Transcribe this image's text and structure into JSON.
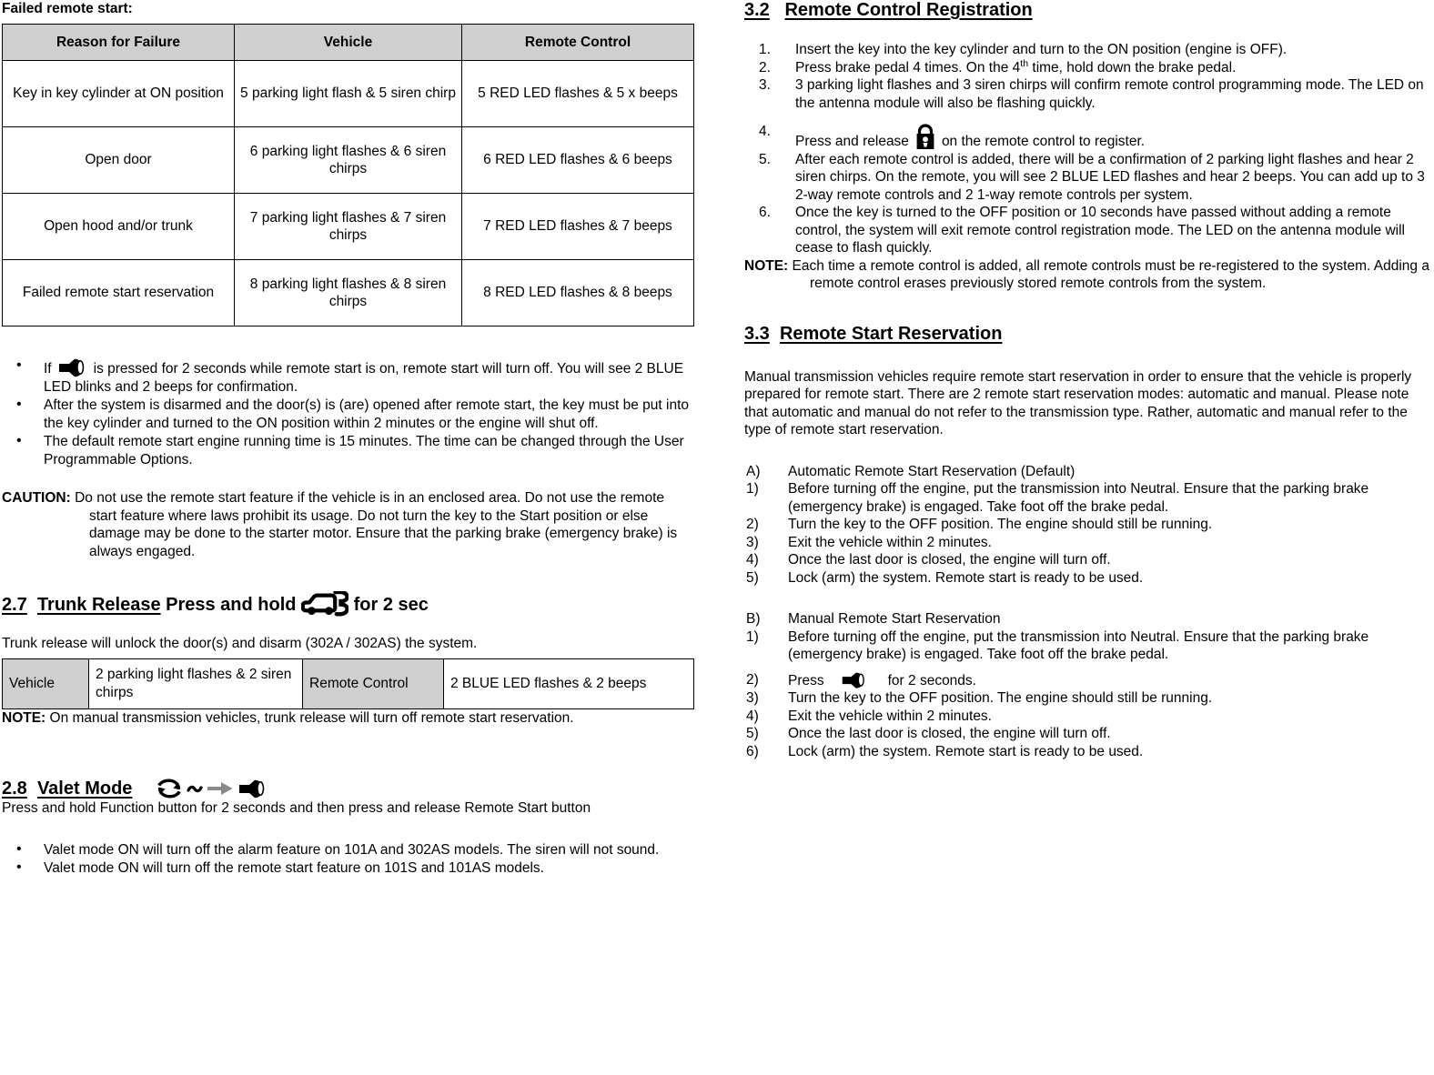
{
  "left_column": {
    "lead_heading": "Failed remote start:",
    "fail_table": {
      "headers": [
        "Reason for Failure",
        "Vehicle",
        "Remote Control"
      ],
      "rows": [
        [
          "Key in key cylinder at ON position",
          "5 parking light flash & 5 siren chirp",
          "5 RED LED flashes & 5 x beeps"
        ],
        [
          "Open door",
          "6 parking light flashes & 6 siren chirps",
          "6 RED LED flashes & 6 beeps"
        ],
        [
          "Open hood and/or trunk",
          "7 parking light flashes & 7 siren chirps",
          "7 RED LED flashes & 7 beeps"
        ],
        [
          "Failed remote start reservation",
          "8 parking light flashes & 8 siren chirps",
          "8 RED LED flashes & 8 beeps"
        ]
      ]
    },
    "bullets": [
      {
        "icon": "horn-icon",
        "before": "If",
        "after": "is pressed for 2 seconds while remote start is on, remote start will turn off. You will see 2 BLUE LED blinks and 2 beeps for confirmation."
      },
      {
        "icon": null,
        "before": "",
        "after": "After the system is disarmed and the door(s) is (are) opened after remote start, the key must be put into the key cylinder and turned to the ON position within 2 minutes or the engine will shut off."
      },
      {
        "icon": null,
        "before": "",
        "after": "The default remote start engine running time is 15 minutes.  The time can be changed through the User Programmable Options."
      }
    ],
    "caution": {
      "label": "CAUTION:",
      "text": "Do not use the remote start feature if the vehicle is in an enclosed area.  Do not use the remote start feature where laws prohibit its usage.  Do not turn the key to the Start position or else damage may be done to the starter motor.  Ensure that the parking brake (emergency brake) is always engaged."
    },
    "section_27": {
      "number": "2.7",
      "title": "Trunk Release",
      "suffix_before_icon": "Press and hold",
      "icon": "trunk-open-icon",
      "suffix_after_icon": "for 2 sec",
      "intro": "Trunk release will unlock the door(s) and disarm (302A / 302AS) the system.",
      "table": {
        "cells": [
          "Vehicle",
          "2 parking light flashes & 2 siren chirps",
          "Remote Control",
          "2 BLUE LED flashes & 2 beeps"
        ]
      },
      "note_label": "NOTE:",
      "note_text": "On manual transmission vehicles, trunk release will turn off remote start reservation."
    },
    "section_28": {
      "number": "2.8",
      "title": "Valet Mode",
      "icons": [
        "cycle-arrows-icon",
        "tilde-icon",
        "right-arrow-icon",
        "horn-icon"
      ],
      "body": "Press and hold Function button for 2 seconds and then press and release Remote Start button",
      "bullets": [
        "Valet mode ON will turn off the alarm feature on 101A and 302AS models. The siren will not sound.",
        "Valet mode ON will turn off the remote start feature on 101S and 101AS models."
      ]
    }
  },
  "right_column": {
    "section_32": {
      "number": "3.2",
      "title": "Remote Control Registration",
      "items": [
        {
          "text": "Insert the key into the key cylinder and turn to the ON position (engine is OFF)."
        },
        {
          "text_a": "Press brake pedal 4 times.  On the 4",
          "sup": "th",
          "text_b": " time, hold down the brake pedal."
        },
        {
          "text": "3 parking light flashes and 3 siren chirps will confirm remote control programming mode.  The LED on the antenna module will also be flashing quickly."
        },
        {
          "text_a": "Press and release",
          "icon": "padlock-icon",
          "text_b": "on the remote control to register."
        },
        {
          "text": "After each remote control is added, there will be a confirmation of 2 parking light flashes and hear 2 siren chirps. On the remote, you will see 2 BLUE LED flashes and hear 2 beeps. You can add up to 3 2-way remote controls and 2 1-way remote controls per system."
        },
        {
          "text": "Once the key is turned to the OFF position or 10 seconds have passed without adding a remote control, the system will exit remote control registration mode.  The LED on the antenna module will cease to flash quickly."
        }
      ],
      "note_label": "NOTE:",
      "note_text": "Each time a remote control is added, all remote controls must be re-registered to the system.  Adding a remote control erases previously stored remote controls from the system."
    },
    "section_33": {
      "number": "3.3",
      "title": "Remote Start Reservation",
      "intro": "Manual transmission vehicles require remote start reservation in order to ensure that the vehicle is properly prepared for remote start.  There are 2 remote start reservation modes: automatic and manual.  Please note that automatic and manual do not refer to the transmission type.  Rather, automatic and manual refer to the type of remote start reservation.",
      "group_a": {
        "marker": "A)",
        "heading": "Automatic Remote Start Reservation (Default)",
        "items": [
          {
            "text": "Before turning off the engine, put the transmission into Neutral.  Ensure that the parking brake (emergency brake) is engaged.  Take foot off the brake pedal."
          },
          {
            "text": "Turn the key to the OFF position.  The engine should still be running."
          },
          {
            "text": "Exit the vehicle within 2 minutes."
          },
          {
            "text": "Once the last door is closed, the engine will turn off."
          },
          {
            "text": "Lock (arm) the system.  Remote start is ready to be used."
          }
        ]
      },
      "group_b": {
        "marker": "B)",
        "heading": "Manual Remote Start Reservation",
        "items": [
          {
            "text": "Before turning off the engine, put the transmission into Neutral.  Ensure that the parking brake (emergency brake) is engaged.  Take foot off the brake pedal."
          },
          {
            "text_a": "Press",
            "icon": "horn-icon",
            "text_b": "for 2 seconds."
          },
          {
            "text": "Turn the key to the OFF position.  The engine should still be running."
          },
          {
            "text": "Exit the vehicle within 2 minutes."
          },
          {
            "text": "Once the last door is closed, the engine will turn off."
          },
          {
            "text": "Lock (arm) the system.  Remote start is ready to be used."
          }
        ]
      }
    }
  },
  "colors": {
    "table_header_gray": "#cfcfcf",
    "border_black": "#000000",
    "arrow_gray": "#808080"
  }
}
